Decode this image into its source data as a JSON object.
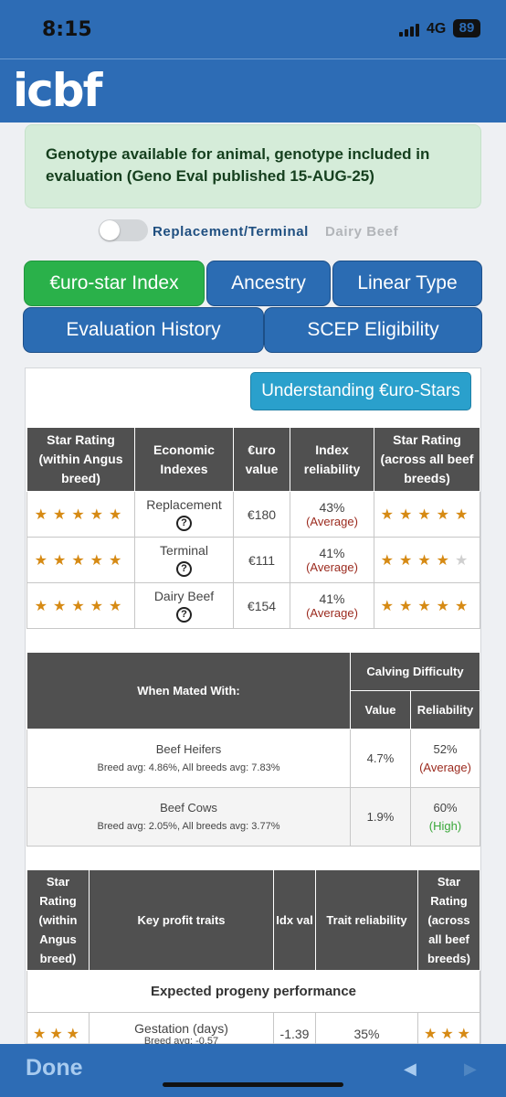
{
  "status_bar": {
    "time": "8:15",
    "network": "4G",
    "battery": "89"
  },
  "brand": {
    "logo_text": "icbf"
  },
  "geno_notice": "Genotype available for animal, genotype included in evaluation (Geno Eval published 15-AUG-25)",
  "toggle": {
    "label_active": "Replacement/Terminal",
    "label_inactive": "Dairy Beef"
  },
  "tabs": {
    "eurostar": "€uro-star Index",
    "ancestry": "Ancestry",
    "linear": "Linear Type",
    "history": "Evaluation History",
    "scep": "SCEP Eligibility"
  },
  "understand_button": "Understanding €uro-Stars",
  "index_table": {
    "headers": {
      "star_within": "Star Rating (within Angus breed)",
      "economic": "Economic Indexes",
      "euro": "€uro value",
      "reliability": "Index reliability",
      "star_across": "Star Rating (across all beef breeds)"
    },
    "rows": [
      {
        "name": "Replacement",
        "value": "€180",
        "reliability": "43%",
        "rel_label": "(Average)",
        "stars_within": 5,
        "stars_across": 5
      },
      {
        "name": "Terminal",
        "value": "€111",
        "reliability": "41%",
        "rel_label": "(Average)",
        "stars_within": 5,
        "stars_across": 4
      },
      {
        "name": "Dairy Beef",
        "value": "€154",
        "reliability": "41%",
        "rel_label": "(Average)",
        "stars_within": 5,
        "stars_across": 5
      }
    ]
  },
  "calving_table": {
    "mated_header": "When Mated With:",
    "group_header": "Calving Difficulty",
    "value_header": "Value",
    "reliability_header": "Reliability",
    "rows": [
      {
        "name": "Beef Heifers",
        "sub": "Breed avg: 4.86%, All breeds avg: 7.83%",
        "value": "4.7%",
        "reliability": "52%",
        "rel_label": "(Average)"
      },
      {
        "name": "Beef Cows",
        "sub": "Breed avg: 2.05%, All breeds avg: 3.77%",
        "value": "1.9%",
        "reliability": "60%",
        "rel_label": "(High)"
      }
    ]
  },
  "traits_table": {
    "headers": {
      "star_within": "Star Rating (within Angus breed)",
      "traits": "Key profit traits",
      "idx": "Idx val",
      "reliability": "Trait reliability",
      "star_across": "Star Rating (across all beef breeds)"
    },
    "section": "Expected progeny performance",
    "rows": [
      {
        "name": "Gestation (days)",
        "sub": "Breed avg: -0.57",
        "value": "-1.39",
        "reliability": "35%",
        "stars_within": 3,
        "stars_across": 3
      }
    ]
  },
  "bottom_bar": {
    "done": "Done",
    "back": "◀",
    "forward": "▶"
  },
  "colors": {
    "brand_blue": "#2d6cb5",
    "tab_active": "#2ab14a",
    "tab_blue": "#2b6cb3",
    "star": "#d68a14",
    "table_header": "#505050"
  }
}
